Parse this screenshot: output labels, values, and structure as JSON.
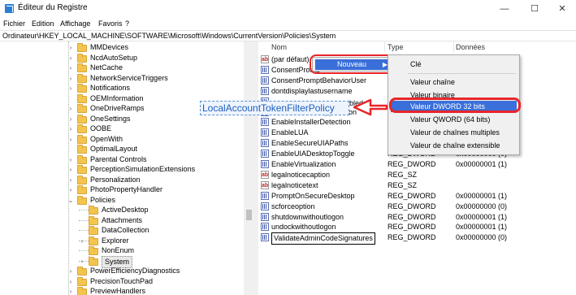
{
  "window": {
    "title": "Éditeur du Registre",
    "minimize_glyph": "—",
    "maximize_glyph": "☐",
    "close_glyph": "✕"
  },
  "menu": [
    "Fichier",
    "Edition",
    "Affichage",
    "Favoris",
    "?"
  ],
  "address": "Ordinateur\\HKEY_LOCAL_MACHINE\\SOFTWARE\\Microsoft\\Windows\\CurrentVersion\\Policies\\System",
  "tree": {
    "items": [
      {
        "label": "MMDevices",
        "level": 0,
        "expanded": false
      },
      {
        "label": "NcdAutoSetup",
        "level": 0,
        "expanded": false
      },
      {
        "label": "NetCache",
        "level": 0,
        "expanded": false
      },
      {
        "label": "NetworkServiceTriggers",
        "level": 0,
        "expanded": false
      },
      {
        "label": "Notifications",
        "level": 0,
        "expanded": false
      },
      {
        "label": "OEMInformation",
        "level": 0,
        "expanded": null
      },
      {
        "label": "OneDriveRamps",
        "level": 0,
        "expanded": false
      },
      {
        "label": "OneSettings",
        "level": 0,
        "expanded": false
      },
      {
        "label": "OOBE",
        "level": 0,
        "expanded": false
      },
      {
        "label": "OpenWith",
        "level": 0,
        "expanded": false
      },
      {
        "label": "OptimalLayout",
        "level": 0,
        "expanded": null
      },
      {
        "label": "Parental Controls",
        "level": 0,
        "expanded": false
      },
      {
        "label": "PerceptionSimulationExtensions",
        "level": 0,
        "expanded": false
      },
      {
        "label": "Personalization",
        "level": 0,
        "expanded": false
      },
      {
        "label": "PhotoPropertyHandler",
        "level": 0,
        "expanded": false
      },
      {
        "label": "Policies",
        "level": 0,
        "expanded": true
      },
      {
        "label": "ActiveDesktop",
        "level": 1,
        "expanded": null
      },
      {
        "label": "Attachments",
        "level": 1,
        "expanded": null
      },
      {
        "label": "DataCollection",
        "level": 1,
        "expanded": null
      },
      {
        "label": "Explorer",
        "level": 1,
        "expanded": false
      },
      {
        "label": "NonEnum",
        "level": 1,
        "expanded": null
      },
      {
        "label": "System",
        "level": 1,
        "expanded": false,
        "selected": true
      },
      {
        "label": "PowerEfficiencyDiagnostics",
        "level": 0,
        "expanded": false
      },
      {
        "label": "PrecisionTouchPad",
        "level": 0,
        "expanded": false
      },
      {
        "label": "PreviewHandlers",
        "level": 0,
        "expanded": false
      }
    ]
  },
  "list": {
    "headers": {
      "name": "Nom",
      "type": "Type",
      "data": "Données"
    },
    "rows": [
      {
        "name": "(par défaut)",
        "type": "",
        "data": "",
        "icon": "string"
      },
      {
        "name": "ConsentPromp",
        "type": "",
        "data": "",
        "icon": "binary"
      },
      {
        "name": "ConsentPromptBehaviorUser",
        "type": "R",
        "data": "",
        "icon": "binary"
      },
      {
        "name": "dontdisplaylastusername",
        "type": "R",
        "data": "",
        "icon": "binary"
      },
      {
        "name": "",
        "type": "R",
        "data": "",
        "icon": "binary"
      },
      {
        "name": "EnableCursorSuppression",
        "type": "R",
        "data": "",
        "icon": "binary"
      },
      {
        "name": "EnableInstallerDetection",
        "type": "R",
        "data": "",
        "icon": "binary"
      },
      {
        "name": "EnableLUA",
        "type": "R",
        "data": "",
        "icon": "binary"
      },
      {
        "name": "EnableSecureUIAPaths",
        "type": "R",
        "data": "",
        "icon": "binary"
      },
      {
        "name": "EnableUIADesktopToggle",
        "type": "REG_DWORD",
        "data": "0x00000000 (0)",
        "icon": "binary"
      },
      {
        "name": "EnableVirtualization",
        "type": "REG_DWORD",
        "data": "0x00000001 (1)",
        "icon": "binary"
      },
      {
        "name": "legalnoticecaption",
        "type": "REG_SZ",
        "data": "",
        "icon": "string"
      },
      {
        "name": "legalnoticetext",
        "type": "REG_SZ",
        "data": "",
        "icon": "string"
      },
      {
        "name": "PromptOnSecureDesktop",
        "type": "REG_DWORD",
        "data": "0x00000001 (1)",
        "icon": "binary"
      },
      {
        "name": "scforceoption",
        "type": "REG_DWORD",
        "data": "0x00000000 (0)",
        "icon": "binary"
      },
      {
        "name": "shutdownwithoutlogon",
        "type": "REG_DWORD",
        "data": "0x00000001 (1)",
        "icon": "binary"
      },
      {
        "name": "undockwithoutlogon",
        "type": "REG_DWORD",
        "data": "0x00000001 (1)",
        "icon": "binary"
      },
      {
        "name": "ValidateAdminCodeSignatures",
        "type": "REG_DWORD",
        "data": "0x00000000 (0)",
        "icon": "binary",
        "editing": true
      }
    ],
    "partial_label": "abled"
  },
  "context_menu": {
    "nouveau": "Nouveau",
    "submenu_arrow": "▶"
  },
  "submenu": {
    "items": [
      "Clé",
      "Valeur chaîne",
      "Valeur binaire",
      "Valeur DWORD 32 bits",
      "Valeur QWORD (64 bits)",
      "Valeur de chaînes multiples",
      "Valeur de chaîne extensible"
    ],
    "highlighted": "Valeur DWORD 32 bits"
  },
  "drag_label": "LocalAccountTokenFilterPolicy",
  "colors": {
    "highlight": "#3a6fd9",
    "annotation_red": "#e8252a",
    "drag_text": "#1c5fc3"
  },
  "icons": {
    "string_glyph": "ab",
    "chevron_right": "›",
    "chevron_down": "⌄"
  }
}
